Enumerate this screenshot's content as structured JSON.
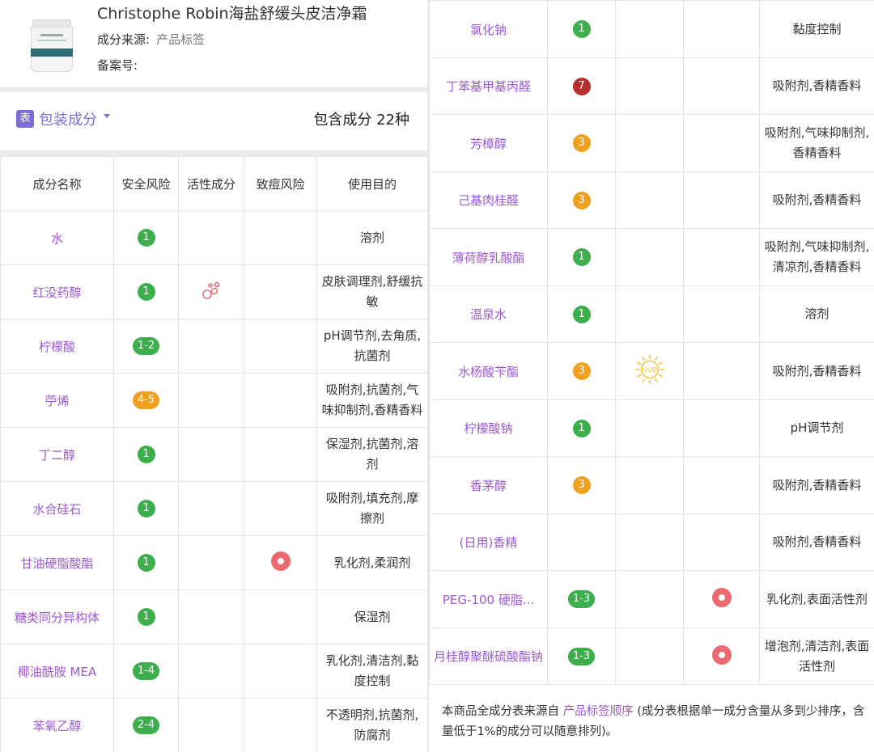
{
  "product": {
    "name": "Christophe Robin海盐舒缓头皮洁净霜",
    "source_label": "成分来源:",
    "source_value": "产品标签",
    "filing_label": "备案号:"
  },
  "section": {
    "tag": "表",
    "title": "包装成分",
    "count": "包含成分 22种"
  },
  "table_headers": [
    "成分名称",
    "安全风险",
    "活性成分",
    "致痘风险",
    "使用目的"
  ],
  "left_rows": [
    {
      "name": "水",
      "risk": "1",
      "risk_color": "green",
      "active": "",
      "acne": "",
      "use": "溶剂"
    },
    {
      "name": "红没药醇",
      "risk": "1",
      "risk_color": "green",
      "active": "bubbles-icon",
      "acne": "",
      "use": "皮肤调理剂,舒缓抗敏"
    },
    {
      "name": "柠檬酸",
      "risk": "1-2",
      "risk_color": "green",
      "active": "",
      "acne": "",
      "use": "pH调节剂,去角质,抗菌剂"
    },
    {
      "name": "苧烯",
      "risk": "4-5",
      "risk_color": "orange",
      "active": "",
      "acne": "",
      "use": "吸附剂,抗菌剂,气味抑制剂,香精香料"
    },
    {
      "name": "丁二醇",
      "risk": "1",
      "risk_color": "green",
      "active": "",
      "acne": "",
      "use": "保湿剂,抗菌剂,溶剂"
    },
    {
      "name": "水合硅石",
      "risk": "1",
      "risk_color": "green",
      "active": "",
      "acne": "",
      "use": "吸附剂,填充剂,摩擦剂"
    },
    {
      "name": "甘油硬脂酸酯",
      "risk": "1",
      "risk_color": "green",
      "active": "",
      "acne": "dot",
      "use": "乳化剂,柔润剂"
    },
    {
      "name": "糖类同分异构体",
      "risk": "1",
      "risk_color": "green",
      "active": "",
      "acne": "",
      "use": "保湿剂"
    },
    {
      "name": "椰油酰胺 MEA",
      "risk": "1-4",
      "risk_color": "green",
      "active": "",
      "acne": "",
      "use": "乳化剂,清洁剂,黏度控制"
    },
    {
      "name": "苯氧乙醇",
      "risk": "2-4",
      "risk_color": "green",
      "active": "",
      "acne": "",
      "use": "不透明剂,抗菌剂,防腐剂"
    }
  ],
  "right_rows": [
    {
      "name": "氯化钠",
      "risk": "1",
      "risk_color": "green",
      "active": "",
      "acne": "",
      "use": "黏度控制"
    },
    {
      "name": "丁苯基甲基丙醛",
      "risk": "7",
      "risk_color": "red",
      "active": "",
      "acne": "",
      "use": "吸附剂,香精香料"
    },
    {
      "name": "芳樟醇",
      "risk": "3",
      "risk_color": "orange",
      "active": "",
      "acne": "",
      "use": "吸附剂,气味抑制剂,香精香料"
    },
    {
      "name": "己基肉桂醛",
      "risk": "3",
      "risk_color": "orange",
      "active": "",
      "acne": "",
      "use": "吸附剂,香精香料"
    },
    {
      "name": "薄荷醇乳酸酯",
      "risk": "1",
      "risk_color": "green",
      "active": "",
      "acne": "",
      "use": "吸附剂,气味抑制剂,清凉剂,香精香料"
    },
    {
      "name": "温泉水",
      "risk": "1",
      "risk_color": "green",
      "active": "",
      "acne": "",
      "use": "溶剂"
    },
    {
      "name": "水杨酸苄酯",
      "risk": "3",
      "risk_color": "orange",
      "active": "UVB",
      "acne": "",
      "use": "吸附剂,香精香料"
    },
    {
      "name": "柠檬酸钠",
      "risk": "1",
      "risk_color": "green",
      "active": "",
      "acne": "",
      "use": "pH调节剂"
    },
    {
      "name": "香茅醇",
      "risk": "3",
      "risk_color": "orange",
      "active": "",
      "acne": "",
      "use": "吸附剂,香精香料"
    },
    {
      "name": "(日用)香精",
      "risk": "",
      "risk_color": "",
      "active": "",
      "acne": "",
      "use": "吸附剂,香精香料"
    },
    {
      "name": "PEG-100 硬脂...",
      "risk": "1-3",
      "risk_color": "green",
      "active": "",
      "acne": "dot",
      "use": "乳化剂,表面活性剂"
    },
    {
      "name": "月桂醇聚醚硫酸酯钠",
      "risk": "1-3",
      "risk_color": "green",
      "active": "",
      "acne": "dot",
      "use": "增泡剂,清洁剂,表面活性剂"
    }
  ],
  "footnote": {
    "prefix": "本商品全成分表来源自 ",
    "link": "产品标签顺序",
    "suffix": " (成分表根据单一成分含量从多到少排序，含量低于1%的成分可以随意排列)。"
  },
  "colors": {
    "accent": "#7b6fd6",
    "ingredient": "#9b59d0",
    "risk_green": "#3cae4b",
    "risk_orange": "#f0a01f",
    "risk_red": "#b72f2f",
    "acne_dot": "#ec6a6f",
    "uvb": "#f2c447"
  }
}
